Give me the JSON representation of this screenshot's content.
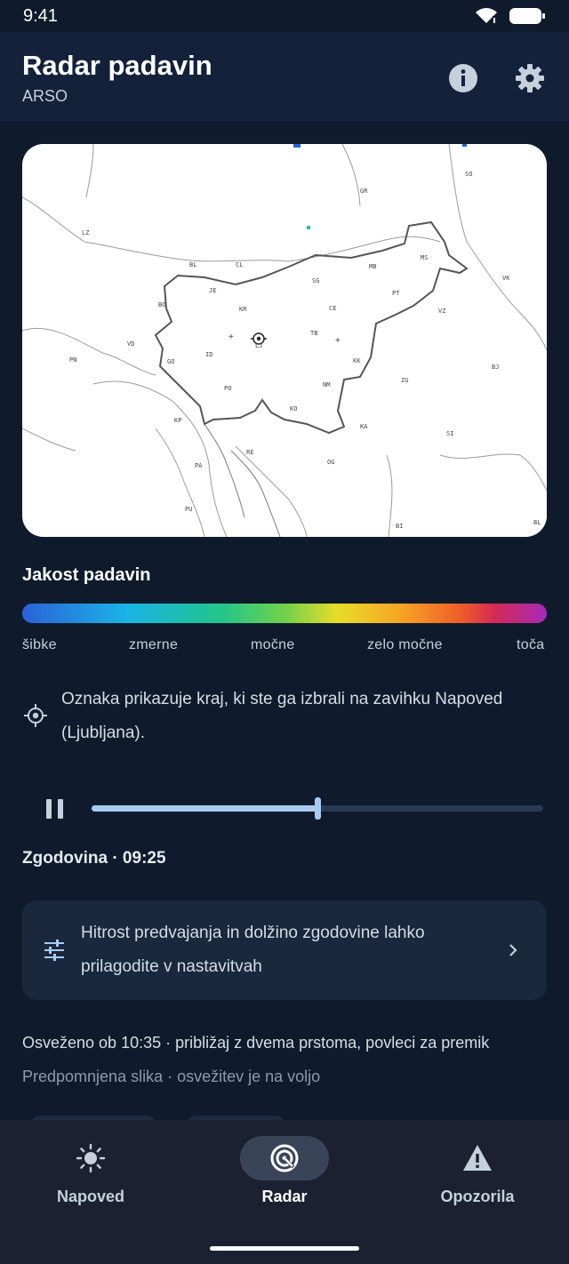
{
  "status": {
    "time": "9:41"
  },
  "header": {
    "title": "Radar padavin",
    "subtitle": "ARSO"
  },
  "map": {
    "labels": [
      "SO",
      "GR",
      "LZ",
      "BL",
      "CL",
      "MB",
      "MS",
      "SG",
      "VK",
      "JE",
      "PT",
      "BO",
      "KR",
      "CE",
      "VZ",
      "LJ",
      "TB",
      "VD",
      "ID",
      "PN",
      "GO",
      "KK",
      "BJ",
      "NM",
      "ZG",
      "PO",
      "KO",
      "KA",
      "SI",
      "KP",
      "RE",
      "PA",
      "OG",
      "PU",
      "BI",
      "BL"
    ]
  },
  "legend": {
    "title": "Jakost padavin",
    "scale": [
      "šibke",
      "zmerne",
      "močne",
      "zelo močne",
      "toča"
    ]
  },
  "info": {
    "text": "Oznaka prikazuje kraj, ki ste ga izbrali na zavihku Napoved (Ljubljana)."
  },
  "player": {
    "progress": 0.5,
    "history_label": "Zgodovina · 09:25"
  },
  "settings_card": {
    "text": "Hitrost predvajanja in dolžino zgodovine lahko prilagodite v nastavitvah"
  },
  "footer": {
    "refreshed": "Osveženo ob 10:35 · približaj z dvema prstoma, povleci za premik",
    "cache": "Predpomnjena slika · osvežitev je na voljo"
  },
  "nav": [
    {
      "label": "Napoved",
      "icon": "sun-icon"
    },
    {
      "label": "Radar",
      "icon": "radar-icon"
    },
    {
      "label": "Opozorila",
      "icon": "warning-icon"
    }
  ],
  "colors": {
    "background": "#0f1b2c",
    "header": "#13223a",
    "accent": "#a8cbf2",
    "nav": "#1b2130"
  }
}
